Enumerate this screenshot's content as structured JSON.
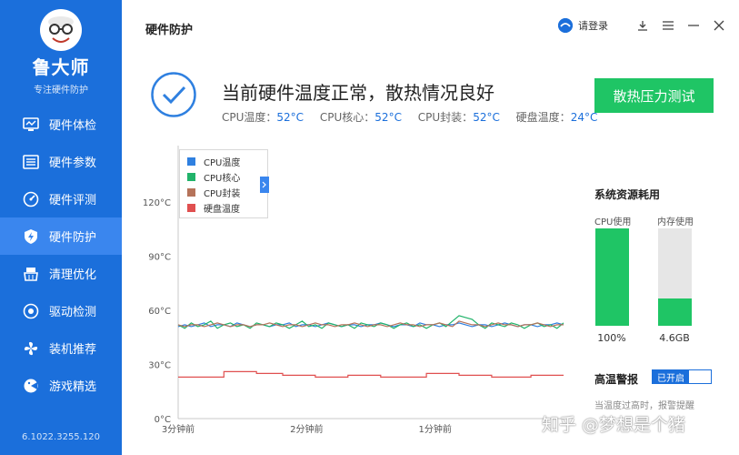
{
  "app": {
    "name": "鲁大师",
    "subtitle": "专注硬件防护",
    "version": "6.1022.3255.120"
  },
  "sidebar": {
    "items": [
      {
        "label": "硬件体检",
        "icon": "monitor-icon",
        "active": false
      },
      {
        "label": "硬件参数",
        "icon": "list-icon",
        "active": false
      },
      {
        "label": "硬件评测",
        "icon": "gauge-icon",
        "active": false
      },
      {
        "label": "硬件防护",
        "icon": "shield-bolt-icon",
        "active": true
      },
      {
        "label": "清理优化",
        "icon": "broom-icon",
        "active": false
      },
      {
        "label": "驱动检测",
        "icon": "driver-icon",
        "active": false
      },
      {
        "label": "装机推荐",
        "icon": "fan-icon",
        "active": false
      },
      {
        "label": "游戏精选",
        "icon": "game-icon",
        "active": false
      }
    ]
  },
  "titlebar": {
    "title": "硬件防护",
    "login_label": "请登录"
  },
  "status": {
    "headline": "当前硬件温度正常，散热情况良好",
    "readings": [
      {
        "label": "CPU温度：",
        "value": "52°C"
      },
      {
        "label": "CPU核心：",
        "value": "52°C"
      },
      {
        "label": "CPU封装：",
        "value": "52°C"
      },
      {
        "label": "硬盘温度：",
        "value": "24°C"
      }
    ],
    "stress_button": "散热压力测试"
  },
  "chart_data": {
    "type": "line",
    "y_ticks": [
      "120°C",
      "90°C",
      "60°C",
      "30°C",
      "0°C"
    ],
    "x_ticks": [
      "3分钟前",
      "2分钟前",
      "1分钟前"
    ],
    "ylim": [
      0,
      120
    ],
    "x": [
      0,
      1,
      2,
      3,
      4,
      5,
      6,
      7,
      8,
      9,
      10,
      11,
      12,
      13,
      14,
      15,
      16,
      17,
      18,
      19,
      20,
      21,
      22,
      23,
      24,
      25,
      26,
      27,
      28,
      29,
      30,
      31,
      32,
      33,
      34,
      35,
      36,
      37,
      38,
      39,
      40,
      41,
      42,
      43,
      44,
      45,
      46,
      47,
      48,
      49,
      50,
      51,
      52,
      53,
      54,
      55,
      56,
      57,
      58,
      59
    ],
    "series": [
      {
        "name": "CPU温度",
        "color": "#2f80e0",
        "values": [
          51,
          52,
          51,
          52,
          53,
          51,
          52,
          52,
          51,
          53,
          52,
          51,
          52,
          52,
          51,
          52,
          52,
          53,
          51,
          52,
          52,
          51,
          52,
          53,
          52,
          51,
          52,
          52,
          51,
          52,
          52,
          53,
          52,
          51,
          52,
          52,
          51,
          53,
          52,
          52,
          51,
          52,
          52,
          53,
          52,
          51,
          52,
          52,
          51,
          52,
          53,
          52,
          51,
          52,
          52,
          51,
          52,
          52,
          53,
          52
        ]
      },
      {
        "name": "CPU核心",
        "color": "#21b36a",
        "values": [
          52,
          50,
          53,
          51,
          52,
          54,
          50,
          52,
          53,
          51,
          52,
          50,
          53,
          52,
          51,
          53,
          52,
          50,
          52,
          54,
          51,
          52,
          50,
          53,
          52,
          51,
          52,
          50,
          53,
          52,
          51,
          53,
          52,
          50,
          52,
          53,
          51,
          52,
          50,
          52,
          53,
          51,
          54,
          57,
          56,
          55,
          52,
          50,
          53,
          52,
          51,
          53,
          52,
          50,
          52,
          53,
          51,
          52,
          50,
          53
        ]
      },
      {
        "name": "CPU封装",
        "color": "#b5735a",
        "values": [
          52,
          51,
          52,
          52,
          51,
          52,
          53,
          52,
          51,
          52,
          52,
          51,
          52,
          52,
          53,
          52,
          51,
          52,
          52,
          51,
          52,
          53,
          52,
          52,
          51,
          52,
          52,
          53,
          52,
          51,
          52,
          52,
          51,
          52,
          53,
          52,
          52,
          51,
          52,
          52,
          53,
          52,
          51,
          54,
          53,
          52,
          52,
          51,
          52,
          53,
          52,
          52,
          51,
          52,
          52,
          53,
          52,
          51,
          52,
          52
        ]
      },
      {
        "name": "硬盘温度",
        "color": "#e05050",
        "values": [
          23,
          23,
          23,
          23,
          23,
          23,
          23,
          26,
          26,
          26,
          26,
          26,
          25,
          25,
          25,
          25,
          24,
          24,
          24,
          24,
          24,
          23,
          23,
          23,
          23,
          23,
          24,
          24,
          24,
          24,
          24,
          23,
          23,
          23,
          23,
          23,
          23,
          23,
          25,
          25,
          25,
          25,
          25,
          24,
          24,
          24,
          24,
          24,
          23,
          23,
          23,
          23,
          23,
          23,
          24,
          24,
          24,
          24,
          24,
          24
        ]
      }
    ]
  },
  "resources": {
    "title": "系统资源耗用",
    "cpu": {
      "label": "CPU使用",
      "percent": 100,
      "value": "100%"
    },
    "mem": {
      "label": "内存使用",
      "percent": 28,
      "value": "4.6GB"
    }
  },
  "alarm": {
    "title": "高温警报",
    "toggle_label": "已开启",
    "description": "当温度过高时，报警提醒"
  },
  "watermark": "知乎 @梦想是个猪"
}
